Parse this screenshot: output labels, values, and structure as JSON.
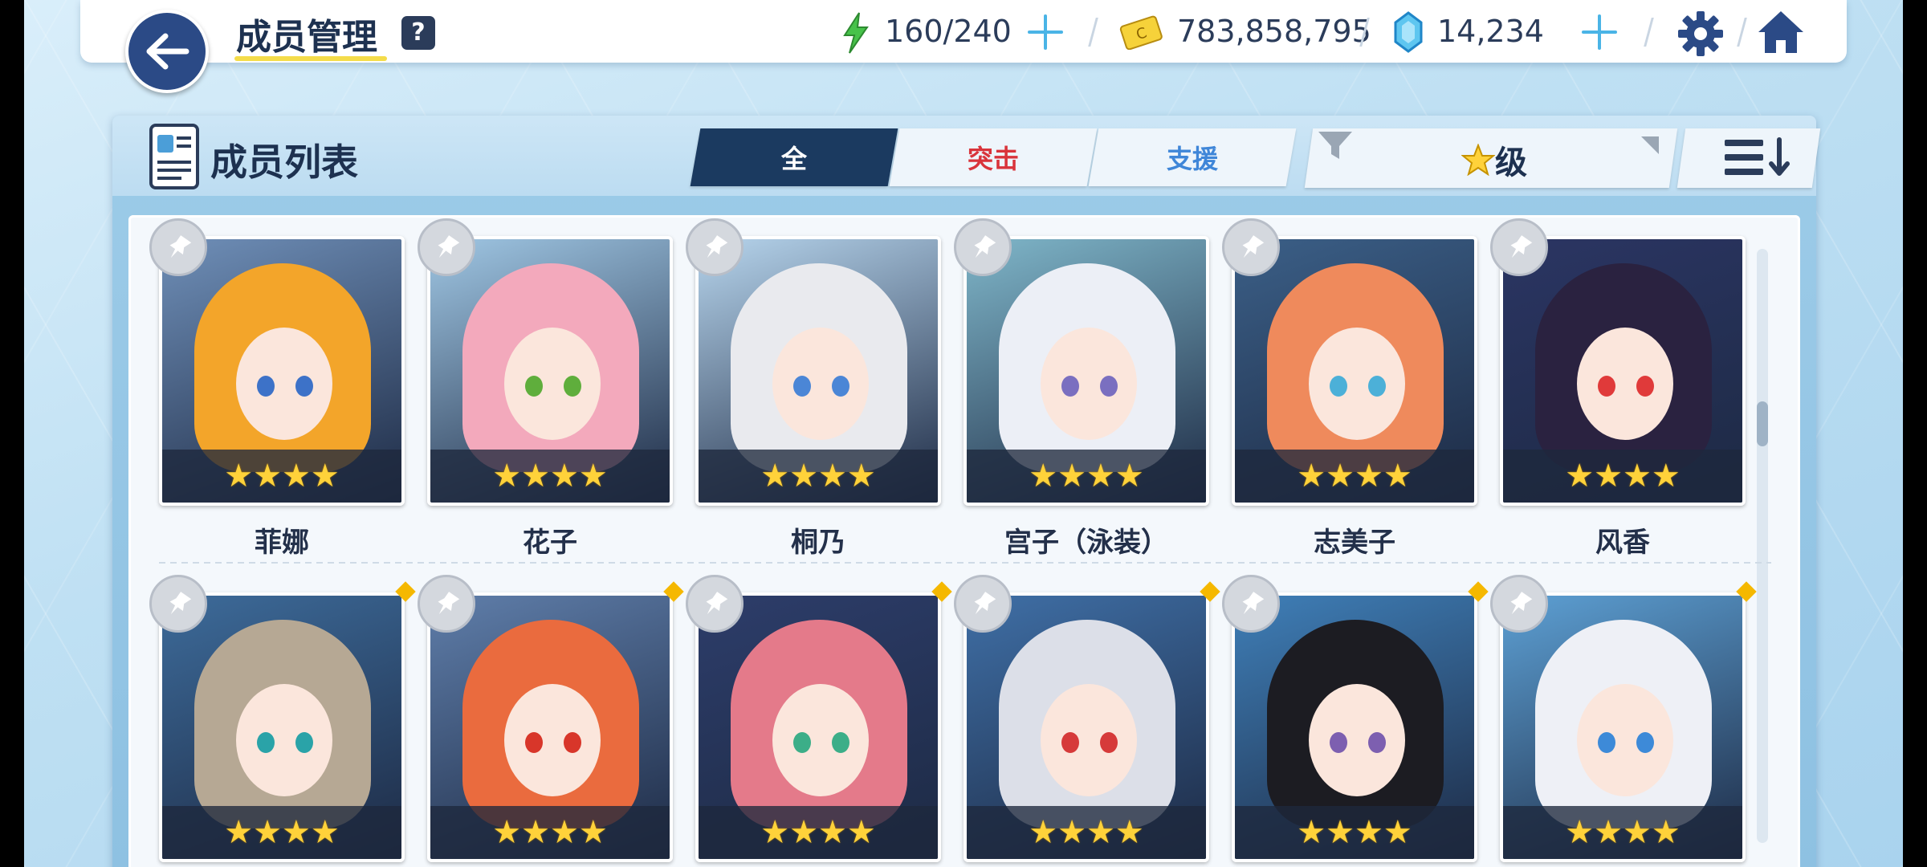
{
  "header": {
    "title": "成员管理",
    "help": "?",
    "ap": "160/240",
    "credits": "783,858,795",
    "pyroxene": "14,234"
  },
  "panel": {
    "title": "成员列表",
    "tabs": [
      {
        "label": "全",
        "color": "#ffffff"
      },
      {
        "label": "突击",
        "color": "#d9343b"
      },
      {
        "label": "支援",
        "color": "#3f86d8"
      }
    ],
    "filter_label": "级"
  },
  "characters": [
    {
      "name": "菲娜",
      "stars": "★★★★",
      "hair": "#f3a52a",
      "bg": "#6f8fb8",
      "eye": "#3d72c8"
    },
    {
      "name": "花子",
      "stars": "★★★★",
      "hair": "#f3a9bc",
      "bg": "#9fc6e3",
      "eye": "#5fae3c"
    },
    {
      "name": "桐乃",
      "stars": "★★★★",
      "hair": "#e9eaee",
      "bg": "#b6d4ec",
      "eye": "#4b86d6"
    },
    {
      "name": "宫子（泳装）",
      "stars": "★★★★",
      "hair": "#eceff6",
      "bg": "#7fb6c9",
      "eye": "#7a6fc0"
    },
    {
      "name": "志美子",
      "stars": "★★★★",
      "hair": "#ef8a5c",
      "bg": "#3b5f87",
      "eye": "#4cb0d8"
    },
    {
      "name": "风香",
      "stars": "★★★★",
      "hair": "#2a2240",
      "bg": "#2b3563",
      "eye": "#e03a3a"
    },
    {
      "name": "",
      "stars": "★★★★",
      "hair": "#b6a894",
      "bg": "#3d6b9a",
      "eye": "#2aa3a8"
    },
    {
      "name": "",
      "stars": "★★★★",
      "hair": "#ea6b3e",
      "bg": "#5f7eaa",
      "eye": "#d8362a"
    },
    {
      "name": "",
      "stars": "★★★★",
      "hair": "#e47a8a",
      "bg": "#2d3d6a",
      "eye": "#3cae88"
    },
    {
      "name": "",
      "stars": "★★★★",
      "hair": "#dcdfe8",
      "bg": "#3f6fa6",
      "eye": "#d63a3a"
    },
    {
      "name": "",
      "stars": "★★★★",
      "hair": "#1c1c22",
      "bg": "#3f7fb8",
      "eye": "#7d5fb0"
    },
    {
      "name": "",
      "stars": "★★★★",
      "hair": "#eef0f6",
      "bg": "#5da0d4",
      "eye": "#3d8ad8"
    }
  ]
}
